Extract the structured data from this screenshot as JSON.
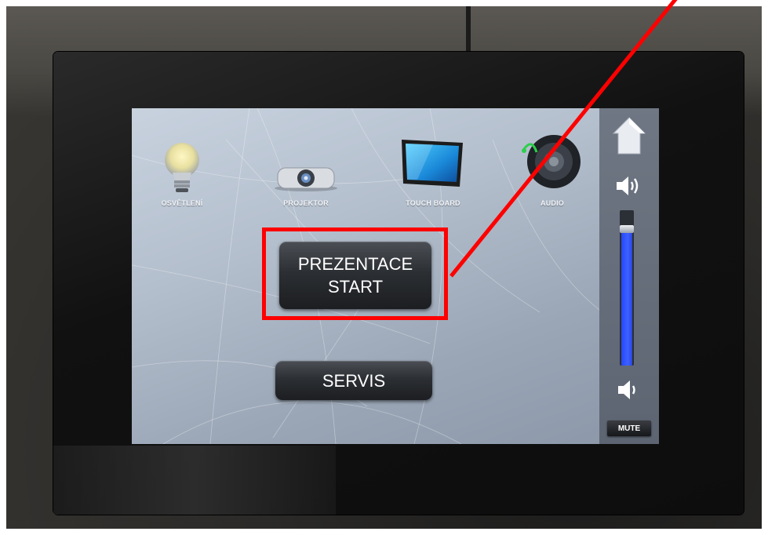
{
  "menu": {
    "items": [
      {
        "label": "OSVĚTLENÍ",
        "icon": "light-bulb-icon"
      },
      {
        "label": "PROJEKTOR",
        "icon": "projector-icon"
      },
      {
        "label": "TOUCH BOARD",
        "icon": "touch-board-icon"
      },
      {
        "label": "AUDIO",
        "icon": "speaker-icon"
      }
    ]
  },
  "buttons": {
    "prezentace_line1": "PREZENTACE",
    "prezentace_line2": "START",
    "servis": "SERVIS"
  },
  "side_panel": {
    "mute_label": "MUTE",
    "volume_level": 0.88
  },
  "annotation": {
    "color": "#ff0000"
  },
  "colors": {
    "screen": "#b4bfcd",
    "button": "#2c2f33",
    "volume_fill": "#2547ff"
  }
}
